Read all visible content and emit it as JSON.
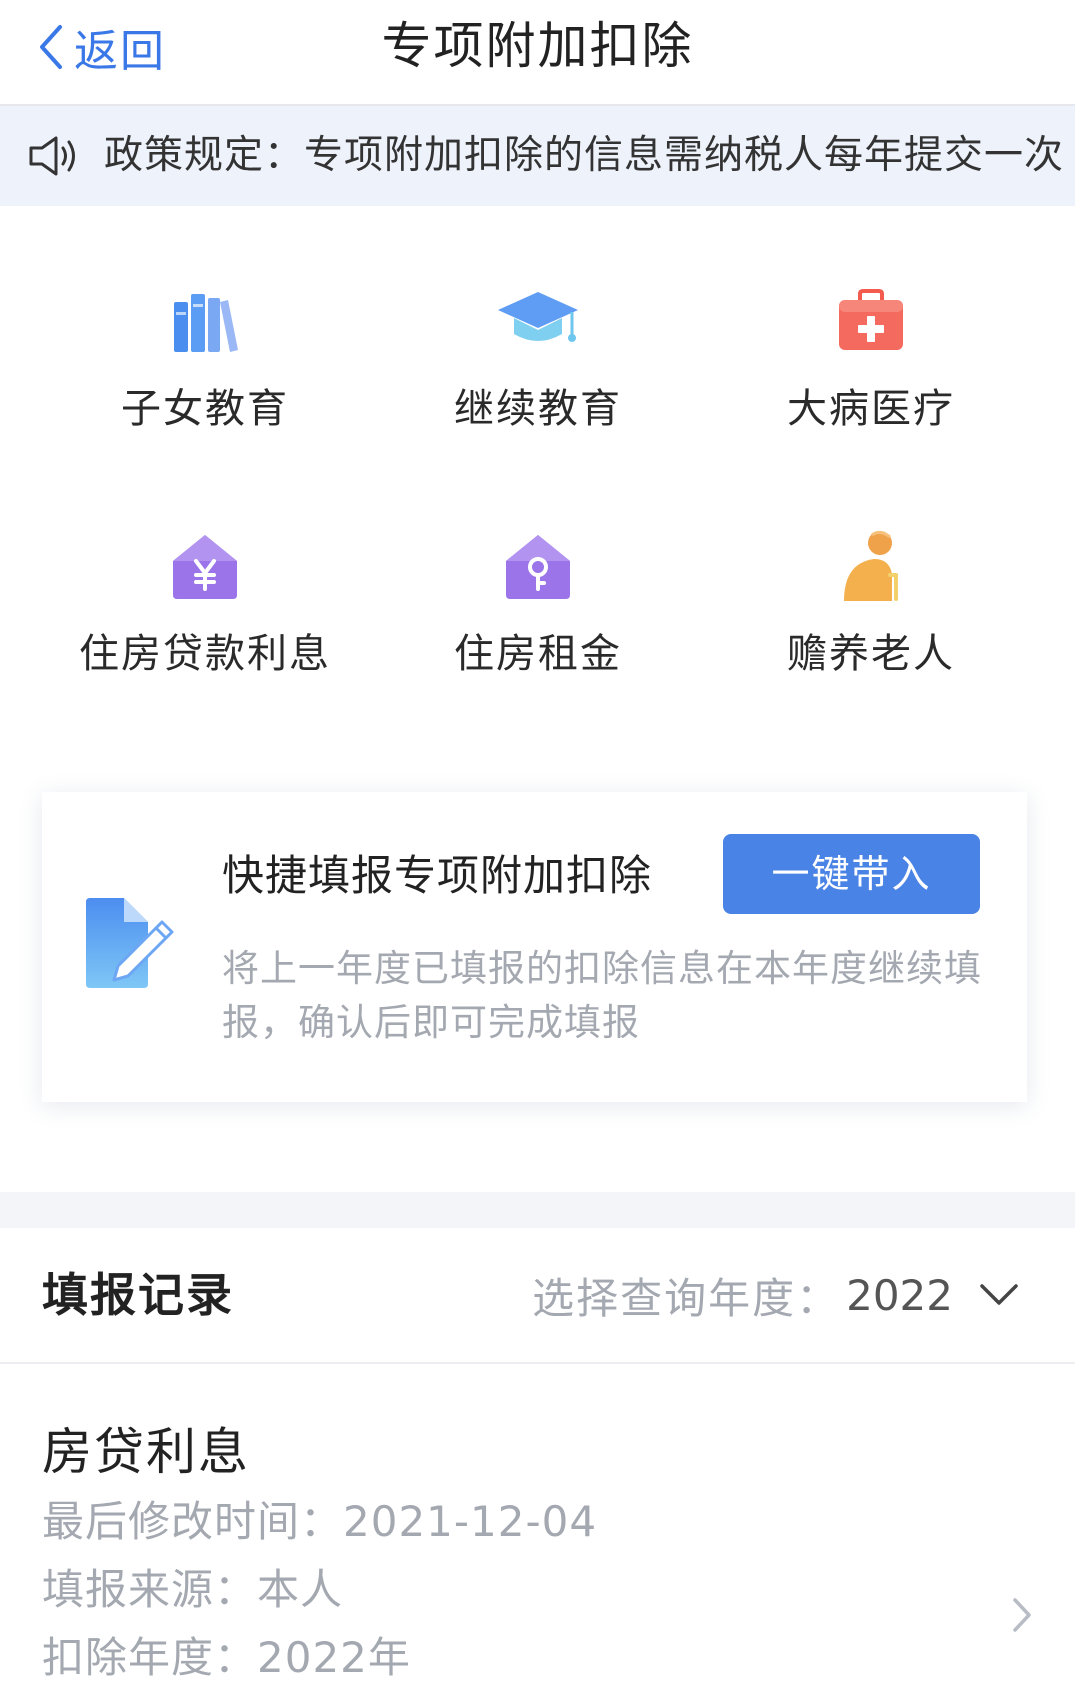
{
  "header": {
    "back_label": "返回",
    "title": "专项附加扣除"
  },
  "notice": {
    "text": "政策规定：专项附加扣除的信息需纳税人每年提交一次"
  },
  "categories": [
    {
      "label": "子女教育",
      "icon": "books-icon"
    },
    {
      "label": "继续教育",
      "icon": "graduation-cap-icon"
    },
    {
      "label": "大病医疗",
      "icon": "medical-kit-icon"
    },
    {
      "label": "住房贷款利息",
      "icon": "house-yuan-icon"
    },
    {
      "label": "住房租金",
      "icon": "house-key-icon"
    },
    {
      "label": "赡养老人",
      "icon": "elderly-person-icon"
    }
  ],
  "quick_fill": {
    "title": "快捷填报专项附加扣除",
    "button_label": "一键带入",
    "description": "将上一年度已填报的扣除信息在本年度继续填报，确认后即可完成填报"
  },
  "records": {
    "title": "填报记录",
    "year_label": "选择查询年度：",
    "year_value": "2022",
    "items": [
      {
        "name": "房贷利息",
        "modified": "最后修改时间：2021-12-04",
        "source": "填报来源：本人",
        "year": "扣除年度：2022年"
      }
    ]
  },
  "colors": {
    "accent": "#4a83e6",
    "back_link": "#3b78e7",
    "notice_bg": "#eef3fb",
    "muted_text": "#a4a8b0"
  }
}
